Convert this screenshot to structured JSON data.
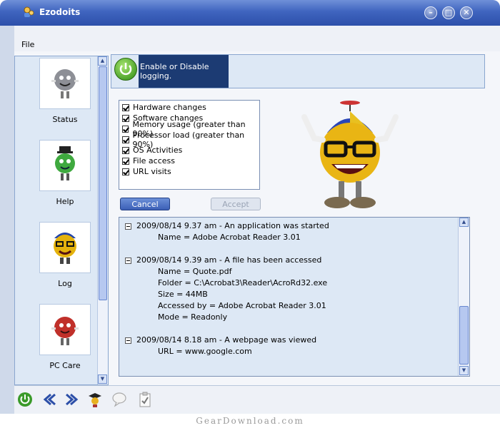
{
  "window": {
    "title": "Ezodoits"
  },
  "menu": {
    "file": "File"
  },
  "nav": [
    {
      "label": "Status",
      "icon": "status-smiley-icon"
    },
    {
      "label": "Help",
      "icon": "help-smiley-icon"
    },
    {
      "label": "Log",
      "icon": "log-smiley-icon"
    },
    {
      "label": "PC Care",
      "icon": "pc-care-smiley-icon"
    }
  ],
  "logging": {
    "banner": "Enable or Disable logging."
  },
  "options": [
    {
      "label": "Hardware changes",
      "checked": true
    },
    {
      "label": "Software changes",
      "checked": true
    },
    {
      "label": "Memory usage (greater than 90%)",
      "checked": true
    },
    {
      "label": "Processor load (greater than 90%)",
      "checked": true
    },
    {
      "label": "OS Activities",
      "checked": true
    },
    {
      "label": "File access",
      "checked": true
    },
    {
      "label": "URL visits",
      "checked": true
    }
  ],
  "buttons": {
    "cancel": "Cancel",
    "accept": "Accept"
  },
  "log": {
    "entries": [
      {
        "header": "2009/08/14 9.37 am - An application was started",
        "details": [
          "Name = Adobe Acrobat Reader 3.01"
        ]
      },
      {
        "header": "2009/08/14 9.39 am - A file has been accessed",
        "details": [
          "Name = Quote.pdf",
          "Folder = C:\\Acrobat3\\Reader\\AcroRd32.exe",
          "Size = 44MB",
          "Accessed by = Adobe Acrobat Reader 3.01",
          "Mode = Readonly"
        ]
      },
      {
        "header": "2009/08/14 8.18 am - A webpage was viewed",
        "details": [
          "URL = www.google.com"
        ]
      }
    ]
  },
  "toolbar": [
    "power-icon",
    "back-icon",
    "forward-icon",
    "graduate-icon",
    "speech-bubble-icon",
    "clipboard-check-icon"
  ],
  "watermark": "GearDownload.com",
  "colors": {
    "title_bar": "#3f64bf",
    "banner": "#1c3b73",
    "panel": "#dde8f5"
  }
}
